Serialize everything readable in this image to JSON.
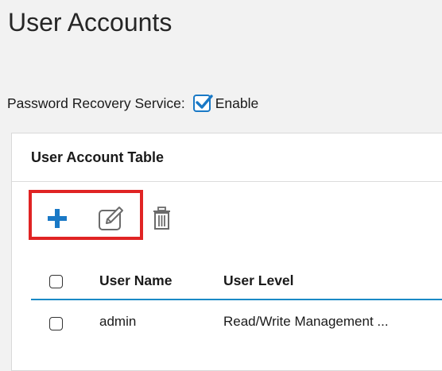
{
  "page": {
    "title": "User Accounts"
  },
  "password_recovery": {
    "label": "Password Recovery Service:",
    "enabled": true,
    "option_label": "Enable"
  },
  "table": {
    "title": "User Account Table",
    "toolbar": {
      "add_icon": "plus-icon",
      "edit_icon": "edit-icon",
      "delete_icon": "trash-icon"
    },
    "columns": [
      "User Name",
      "User Level"
    ],
    "rows": [
      {
        "user_name": "admin",
        "user_level": "Read/Write Management ..."
      }
    ]
  },
  "colors": {
    "accent": "#1a79c6",
    "highlight": "#e02424",
    "table_rule": "#1a8ac6"
  }
}
